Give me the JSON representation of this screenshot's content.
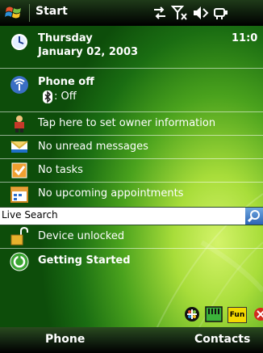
{
  "titlebar": {
    "start_label": "Start",
    "icons": [
      "sync-icon",
      "no-signal-icon",
      "volume-mute-icon",
      "connection-icon"
    ],
    "clock": "11:0"
  },
  "today": {
    "date": {
      "weekday": "Thursday",
      "full_date": "January 02, 2003",
      "icon": "clock-icon"
    },
    "phone": {
      "status": "Phone off",
      "bluetooth": ": Off",
      "icon": "phone-antenna-icon",
      "bt_icon": "bluetooth-icon"
    },
    "owner": {
      "label": "Tap here to set owner information",
      "icon": "owner-icon"
    },
    "messages": {
      "label": "No unread messages",
      "icon": "envelope-icon"
    },
    "tasks": {
      "label": "No tasks",
      "icon": "task-check-icon"
    },
    "appointments": {
      "label": "No upcoming appointments",
      "icon": "calendar-icon"
    },
    "search": {
      "label": "Live Search",
      "icon": "search-icon"
    },
    "device": {
      "label": "Device unlocked",
      "icon": "unlocked-padlock-icon"
    },
    "getting_started": {
      "label": "Getting Started",
      "icon": "getting-started-icon"
    }
  },
  "tray": {
    "icons": [
      "windows-live-icon",
      "memory-card-icon",
      "fun-icon",
      "close-icon"
    ],
    "fun_label": "Fun"
  },
  "softkeys": {
    "left": "Phone",
    "right": "Contacts"
  },
  "colors": {
    "background_dark": "#0d4d0a",
    "background_light": "#d4f36a",
    "titlebar": "#000000",
    "search_button": "#2c64b5"
  }
}
